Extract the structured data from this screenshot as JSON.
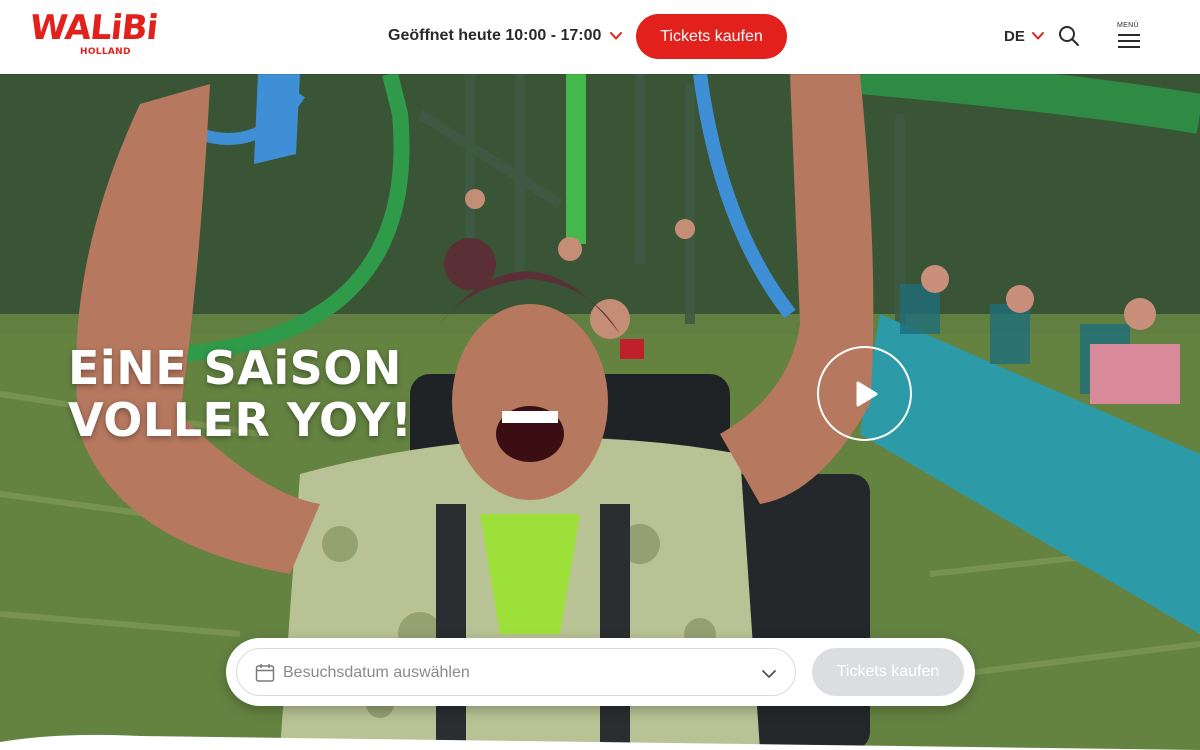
{
  "header": {
    "logo_text": "WALiBi",
    "logo_sub": "HOLLAND",
    "hours_label": "Geöffnet heute 10:00 - 17:00",
    "tickets_button": "Tickets kaufen",
    "language": "DE",
    "menu_label": "MENÜ",
    "icons": {
      "hours_dropdown": "chevron-down-icon",
      "language_dropdown": "chevron-down-icon",
      "search": "search-icon",
      "menu": "hamburger-icon"
    }
  },
  "hero": {
    "headline_line1": "EiNE SAiSON",
    "headline_line2": "VOLLER YOY!",
    "play_icon": "play-icon",
    "image_description_icon": "rollercoaster-photo"
  },
  "booking": {
    "date_placeholder": "Besuchsdatum auswählen",
    "tickets_button": "Tickets kaufen",
    "tickets_button_state": "disabled",
    "icons": {
      "calendar": "calendar-icon",
      "dropdown": "chevron-down-icon"
    }
  },
  "colors": {
    "brand_red": "#e2211c",
    "text_dark": "#2a2a2a",
    "disabled_button": "#dcdde0",
    "placeholder": "#8a8a8a"
  }
}
